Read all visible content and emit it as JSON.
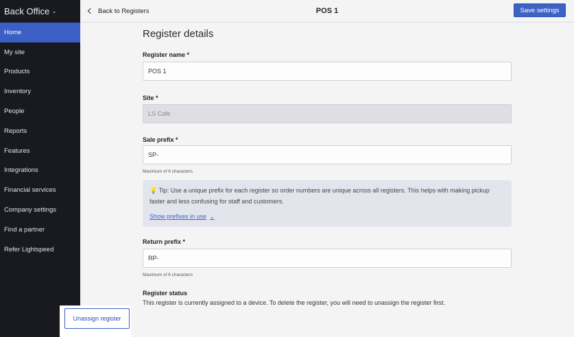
{
  "sidebar": {
    "brand": "Back Office",
    "items": [
      {
        "label": "Home",
        "active": true
      },
      {
        "label": "My site"
      },
      {
        "label": "Products"
      },
      {
        "label": "Inventory"
      },
      {
        "label": "People"
      },
      {
        "label": "Reports"
      },
      {
        "label": "Features"
      },
      {
        "label": "Integrations"
      },
      {
        "label": "Financial services"
      },
      {
        "label": "Company settings"
      },
      {
        "label": "Find a partner"
      },
      {
        "label": "Refer Lightspeed"
      }
    ]
  },
  "topbar": {
    "back_label": "Back to Registers",
    "title": "POS 1",
    "save_label": "Save settings"
  },
  "form": {
    "heading": "Register details",
    "register_name": {
      "label": "Register name *",
      "value": "POS 1"
    },
    "site": {
      "label": "Site *",
      "value": "LS Cafe"
    },
    "sale_prefix": {
      "label": "Sale prefix *",
      "value": "SP-",
      "hint": "Maximum of 6 characters"
    },
    "tip": {
      "icon": "lightbulb-icon",
      "text": "Tip: Use a unique prefix for each register so order numbers are unique across all registers. This helps with making pickup faster and less confusing for staff and customers.",
      "link": "Show prefixes in use"
    },
    "return_prefix": {
      "label": "Return prefix *",
      "value": "RP-",
      "hint": "Maximum of 6 characters"
    },
    "status": {
      "label": "Register status",
      "text": "This register is currently assigned to a device. To delete the register, you will need to unassign the register first.",
      "button": "Unassign register"
    }
  },
  "colors": {
    "accent": "#3d62c6",
    "sidebar_bg": "#181a1f",
    "active_nav": "#3b5fc4"
  }
}
